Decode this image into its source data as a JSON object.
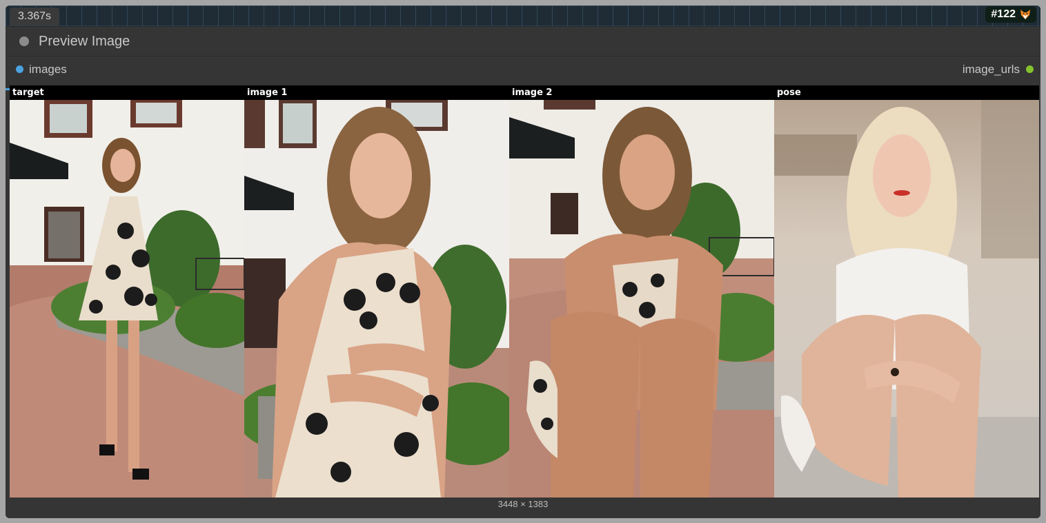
{
  "canvas": {
    "exec_time": "3.367s",
    "node_id_badge": "#122",
    "badge_icon": "fox-icon"
  },
  "node": {
    "title": "Preview Image",
    "input_slot": "images",
    "output_slot": "image_urls",
    "image_size": "3448 × 1383"
  },
  "panels": [
    {
      "label": "target"
    },
    {
      "label": "image 1"
    },
    {
      "label": "image 2"
    },
    {
      "label": "pose"
    }
  ],
  "colors": {
    "input_slot": "#4aa3e0",
    "output_slot": "#84c22e",
    "node_bg": "#353535"
  }
}
